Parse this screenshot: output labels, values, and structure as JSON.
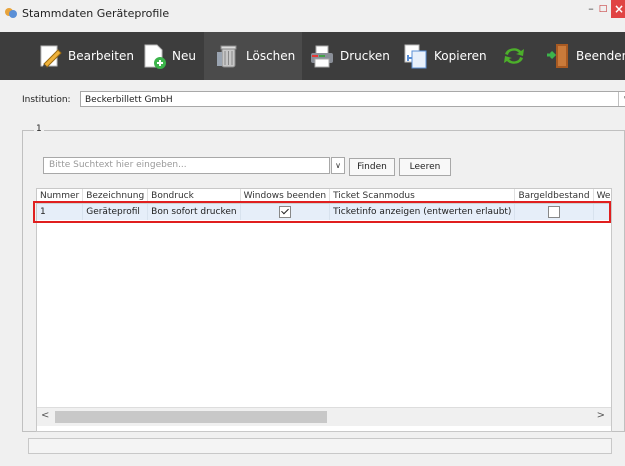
{
  "window": {
    "title": "Stammdaten Geräteprofile",
    "minimize": "–",
    "maximize": "□",
    "close": "×"
  },
  "toolbar": {
    "edit": "Bearbeiten",
    "new": "Neu",
    "delete": "Löschen",
    "print": "Drucken",
    "copy": "Kopieren",
    "exit": "Beenden"
  },
  "institution": {
    "label": "Institution:",
    "value": "Beckerbillett GmbH"
  },
  "group": {
    "legend": "1"
  },
  "search": {
    "placeholder": "Bitte Suchtext hier eingeben...",
    "find_label": "Finden",
    "clear_label": "Leeren"
  },
  "grid": {
    "columns": [
      "Nummer",
      "Bezeichnung",
      "Bondruck",
      "Windows beenden",
      "Ticket Scanmodus",
      "Bargeldbestand",
      "Wechse"
    ],
    "rows": [
      {
        "nummer": "1",
        "bezeichnung": "Geräteprofil",
        "bondruck": "Bon sofort drucken",
        "windows_beenden": true,
        "scanmodus": "Ticketinfo anzeigen (entwerten erlaubt)",
        "bargeldbestand": false
      }
    ]
  },
  "colors": {
    "toolbar_bg": "#3d3d3d",
    "highlight": "#e01f1f",
    "selected_row": "#e6eef9"
  }
}
